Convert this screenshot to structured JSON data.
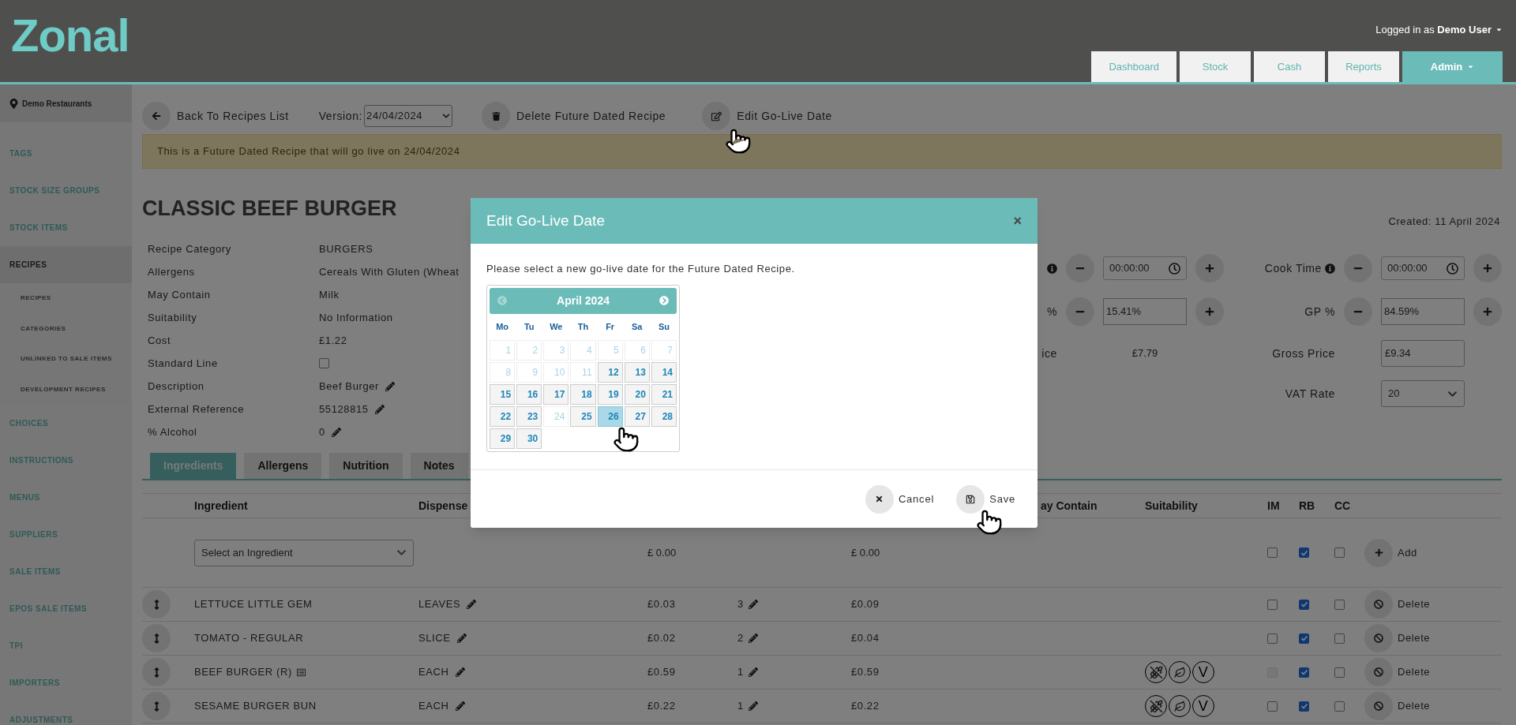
{
  "header": {
    "logo": "Zonal",
    "user_prefix": "Logged in as",
    "user_name": "Demo User",
    "nav": [
      {
        "label": "Dashboard",
        "selected": false
      },
      {
        "label": "Stock",
        "selected": false
      },
      {
        "label": "Cash",
        "selected": false
      },
      {
        "label": "Reports",
        "selected": false
      },
      {
        "label": "Admin",
        "selected": true
      }
    ]
  },
  "sidebar": {
    "location": "Demo Restaurants",
    "items": [
      {
        "label": "TAGS",
        "selected": false
      },
      {
        "label": "STOCK SIZE GROUPS",
        "selected": false
      },
      {
        "label": "STOCK ITEMS",
        "selected": false
      },
      {
        "label": "RECIPES",
        "selected": true,
        "children": [
          {
            "label": "RECIPES"
          },
          {
            "label": "CATEGORIES"
          },
          {
            "label": "UNLINKED TO SALE ITEMS"
          },
          {
            "label": "DEVELOPMENT RECIPES"
          }
        ]
      },
      {
        "label": "CHOICES",
        "selected": false
      },
      {
        "label": "INSTRUCTIONS",
        "selected": false
      },
      {
        "label": "MENUS",
        "selected": false
      },
      {
        "label": "SUPPLIERS",
        "selected": false
      },
      {
        "label": "SALE ITEMS",
        "selected": false
      },
      {
        "label": "EPOS SALE ITEMS",
        "selected": false
      },
      {
        "label": "TPI",
        "selected": false
      },
      {
        "label": "IMPORTERS",
        "selected": false
      },
      {
        "label": "ADJUSTMENTS",
        "selected": false
      }
    ]
  },
  "toolbar": {
    "back": "Back To Recipes List",
    "version_label": "Version:",
    "version": "24/04/2024",
    "delete": "Delete Future Dated Recipe",
    "edit": "Edit Go-Live Date"
  },
  "banner": "This is a Future Dated Recipe that will go live on 24/04/2024",
  "recipe": {
    "title": "CLASSIC BEEF BURGER",
    "created": "Created: 11 April 2024",
    "details": [
      {
        "label": "Recipe Category",
        "kind": "text",
        "value": "BURGERS"
      },
      {
        "label": "Allergens",
        "kind": "text",
        "value": "Cereals With Gluten (Wheat"
      },
      {
        "label": "May Contain",
        "kind": "text",
        "value": "Milk"
      },
      {
        "label": "Suitability",
        "kind": "text",
        "value": "No Information"
      },
      {
        "label": "Cost",
        "kind": "text",
        "value": "£1.22"
      },
      {
        "label": "Standard Line",
        "kind": "checkbox",
        "checked": false
      },
      {
        "label": "Description",
        "kind": "editable",
        "value": "Beef Burger"
      },
      {
        "label": "External Reference",
        "kind": "editable",
        "value": "55128815"
      },
      {
        "label": "% Alcohol",
        "kind": "editable",
        "value": "0"
      }
    ]
  },
  "pricing": [
    {
      "left": {
        "info": true,
        "kind": "time",
        "value": "00:00:00"
      },
      "right": {
        "label": "Cook Time",
        "info": true,
        "kind": "time",
        "value": "00:00:00"
      }
    },
    {
      "left": {
        "label": "%",
        "kind": "stepper",
        "value": "15.41%"
      },
      "right": {
        "label": "GP %",
        "kind": "stepper",
        "value": "84.59%"
      }
    },
    {
      "left": {
        "label": "ice",
        "kind": "text",
        "value": "£7.79"
      },
      "right": {
        "label": "Gross Price",
        "kind": "input",
        "value": "£9.34"
      }
    },
    {
      "right": {
        "label": "VAT Rate",
        "kind": "select",
        "value": "20"
      }
    }
  ],
  "tabs": [
    {
      "label": "Ingredients",
      "selected": true
    },
    {
      "label": "Allergens",
      "selected": false
    },
    {
      "label": "Nutrition",
      "selected": false
    },
    {
      "label": "Notes",
      "selected": false
    }
  ],
  "table": {
    "columns": {
      "ingredient": "Ingredient",
      "dispense": "Dispense",
      "column_7": "ay Contain",
      "suitability": "Suitability",
      "im": "IM",
      "rb": "RB",
      "cc": "CC"
    },
    "new_row": {
      "placeholder": "Select an Ingredient",
      "cost": "£ 0.00",
      "total": "£ 0.00",
      "im": false,
      "rb": true,
      "cc": false,
      "action": "Add"
    },
    "rows": [
      {
        "name": "LETTUCE LITTLE GEM",
        "dispense": "LEAVES",
        "cost": "£0.03",
        "qty": "3",
        "total": "£0.09",
        "im": false,
        "rb": true,
        "cc": false,
        "action": "Delete"
      },
      {
        "name": "TOMATO - REGULAR",
        "dispense": "SLICE",
        "cost": "£0.02",
        "qty": "2",
        "total": "£0.04",
        "im": false,
        "rb": true,
        "cc": false,
        "action": "Delete"
      },
      {
        "name": "BEEF BURGER (R)",
        "recipe_icon": true,
        "dispense": "EACH",
        "cost": "£0.59",
        "qty": "1",
        "total": "£0.59",
        "suitability_letter": "V",
        "im_disabled": true,
        "rb": true,
        "cc": false,
        "action": "Delete"
      },
      {
        "name": "SESAME BURGER BUN",
        "dispense": "EACH",
        "cost": "£0.22",
        "qty": "1",
        "total": "£0.22",
        "suitability_letter": "V",
        "im": false,
        "rb": true,
        "cc": false,
        "action": "Delete"
      }
    ]
  },
  "modal": {
    "title": "Edit Go-Live Date",
    "close": "×",
    "text": "Please select a new go-live date for the Future Dated Recipe.",
    "calendar": {
      "month": "April 2024",
      "prev_disabled": true,
      "weekdays": [
        "Mo",
        "Tu",
        "We",
        "Th",
        "Fr",
        "Sa",
        "Su"
      ],
      "days": [
        {
          "label": "1",
          "disabled": true,
          "selected": false
        },
        {
          "label": "2",
          "disabled": true,
          "selected": false
        },
        {
          "label": "3",
          "disabled": true,
          "selected": false
        },
        {
          "label": "4",
          "disabled": true,
          "selected": false
        },
        {
          "label": "5",
          "disabled": true,
          "selected": false
        },
        {
          "label": "6",
          "disabled": true,
          "selected": false
        },
        {
          "label": "7",
          "disabled": true,
          "selected": false
        },
        {
          "label": "8",
          "disabled": true,
          "selected": false
        },
        {
          "label": "9",
          "disabled": true,
          "selected": false
        },
        {
          "label": "10",
          "disabled": true,
          "selected": false
        },
        {
          "label": "11",
          "disabled": true,
          "selected": false
        },
        {
          "label": "12",
          "disabled": false,
          "selected": false
        },
        {
          "label": "13",
          "disabled": false,
          "selected": false
        },
        {
          "label": "14",
          "disabled": false,
          "selected": false
        },
        {
          "label": "15",
          "disabled": false,
          "selected": false
        },
        {
          "label": "16",
          "disabled": false,
          "selected": false
        },
        {
          "label": "17",
          "disabled": false,
          "selected": false
        },
        {
          "label": "18",
          "disabled": false,
          "selected": false
        },
        {
          "label": "19",
          "disabled": false,
          "selected": false
        },
        {
          "label": "20",
          "disabled": false,
          "selected": false
        },
        {
          "label": "21",
          "disabled": false,
          "selected": false
        },
        {
          "label": "22",
          "disabled": false,
          "selected": false
        },
        {
          "label": "23",
          "disabled": false,
          "selected": false
        },
        {
          "label": "24",
          "disabled": true,
          "selected": false
        },
        {
          "label": "25",
          "disabled": false,
          "selected": false
        },
        {
          "label": "26",
          "disabled": false,
          "selected": true
        },
        {
          "label": "27",
          "disabled": false,
          "selected": false
        },
        {
          "label": "28",
          "disabled": false,
          "selected": false
        },
        {
          "label": "29",
          "disabled": false,
          "selected": false
        },
        {
          "label": "30",
          "disabled": false,
          "selected": false
        }
      ]
    },
    "cancel": "Cancel",
    "save": "Save"
  }
}
